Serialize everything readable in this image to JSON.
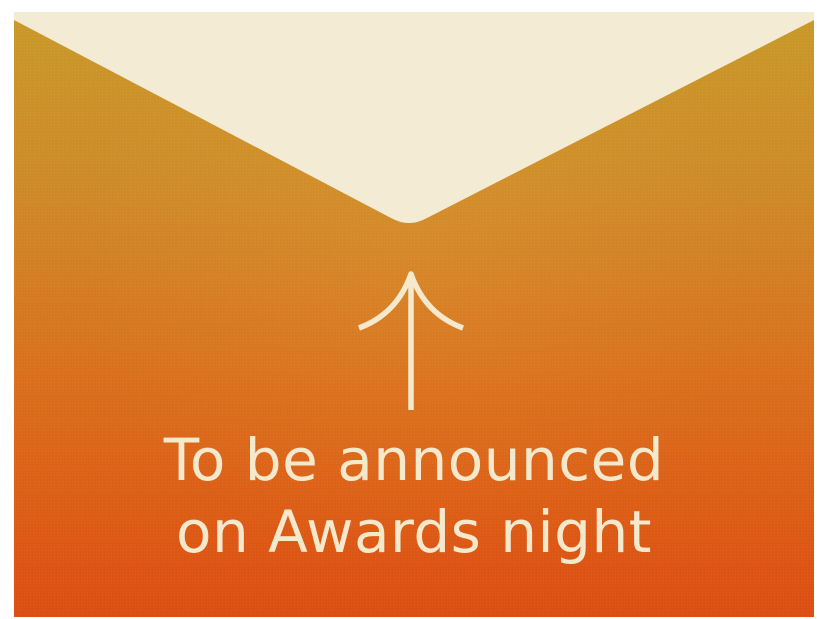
{
  "card": {
    "message_line1": "To be announced",
    "message_line2": "on Awards night",
    "arrow_icon": "arrow-up-icon"
  },
  "colors": {
    "flap": "#f3ebd3",
    "text": "#f5e9cd",
    "gradient_top": "#c99a2a",
    "gradient_bottom": "#dd4e12"
  }
}
